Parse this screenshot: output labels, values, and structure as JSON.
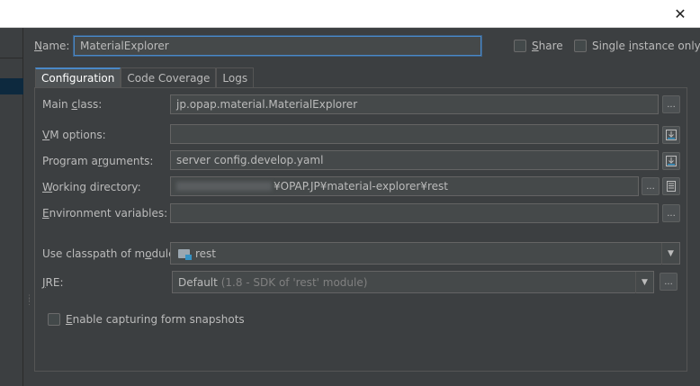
{
  "window": {
    "close_glyph": "✕"
  },
  "name_row": {
    "label_pre": "",
    "label_u": "N",
    "label_post": "ame:",
    "value": "MaterialExplorer",
    "share_u": "S",
    "share_post": "hare",
    "single_pre": "Single ",
    "single_u": "i",
    "single_post": "nstance only"
  },
  "tabs": [
    {
      "label": "Configuration"
    },
    {
      "label": "Code Coverage"
    },
    {
      "label": "Logs"
    }
  ],
  "main_class": {
    "label_pre": "Main ",
    "label_u": "c",
    "label_post": "lass:",
    "value": "jp.opap.material.MaterialExplorer"
  },
  "vm_options": {
    "label_pre": "",
    "label_u": "V",
    "label_post": "M options:",
    "value": ""
  },
  "program_args": {
    "label_pre": "Program a",
    "label_u": "r",
    "label_post": "guments:",
    "value": "server config.develop.yaml"
  },
  "working_dir": {
    "label_pre": "",
    "label_u": "W",
    "label_post": "orking directory:",
    "value_visible": "¥OPAP.JP¥material-explorer¥rest"
  },
  "env_vars": {
    "label_pre": "",
    "label_u": "E",
    "label_post": "nvironment variables:",
    "value": ""
  },
  "classpath": {
    "label_pre": "Use classpath of m",
    "label_u": "o",
    "label_post": "dule:",
    "value": "rest"
  },
  "jre": {
    "label_pre": "",
    "label_u": "J",
    "label_post": "RE:",
    "value_main": "Default",
    "value_detail": "(1.8 - SDK of 'rest' module)"
  },
  "snapshots": {
    "label_pre": "",
    "label_u": "E",
    "label_post": "nable capturing form snapshots"
  },
  "buttons": {
    "ellipsis": "...",
    "dropdown": "▼"
  },
  "colors": {
    "accent": "#4a88c7",
    "background": "#3c3f41",
    "field": "#45494a"
  }
}
